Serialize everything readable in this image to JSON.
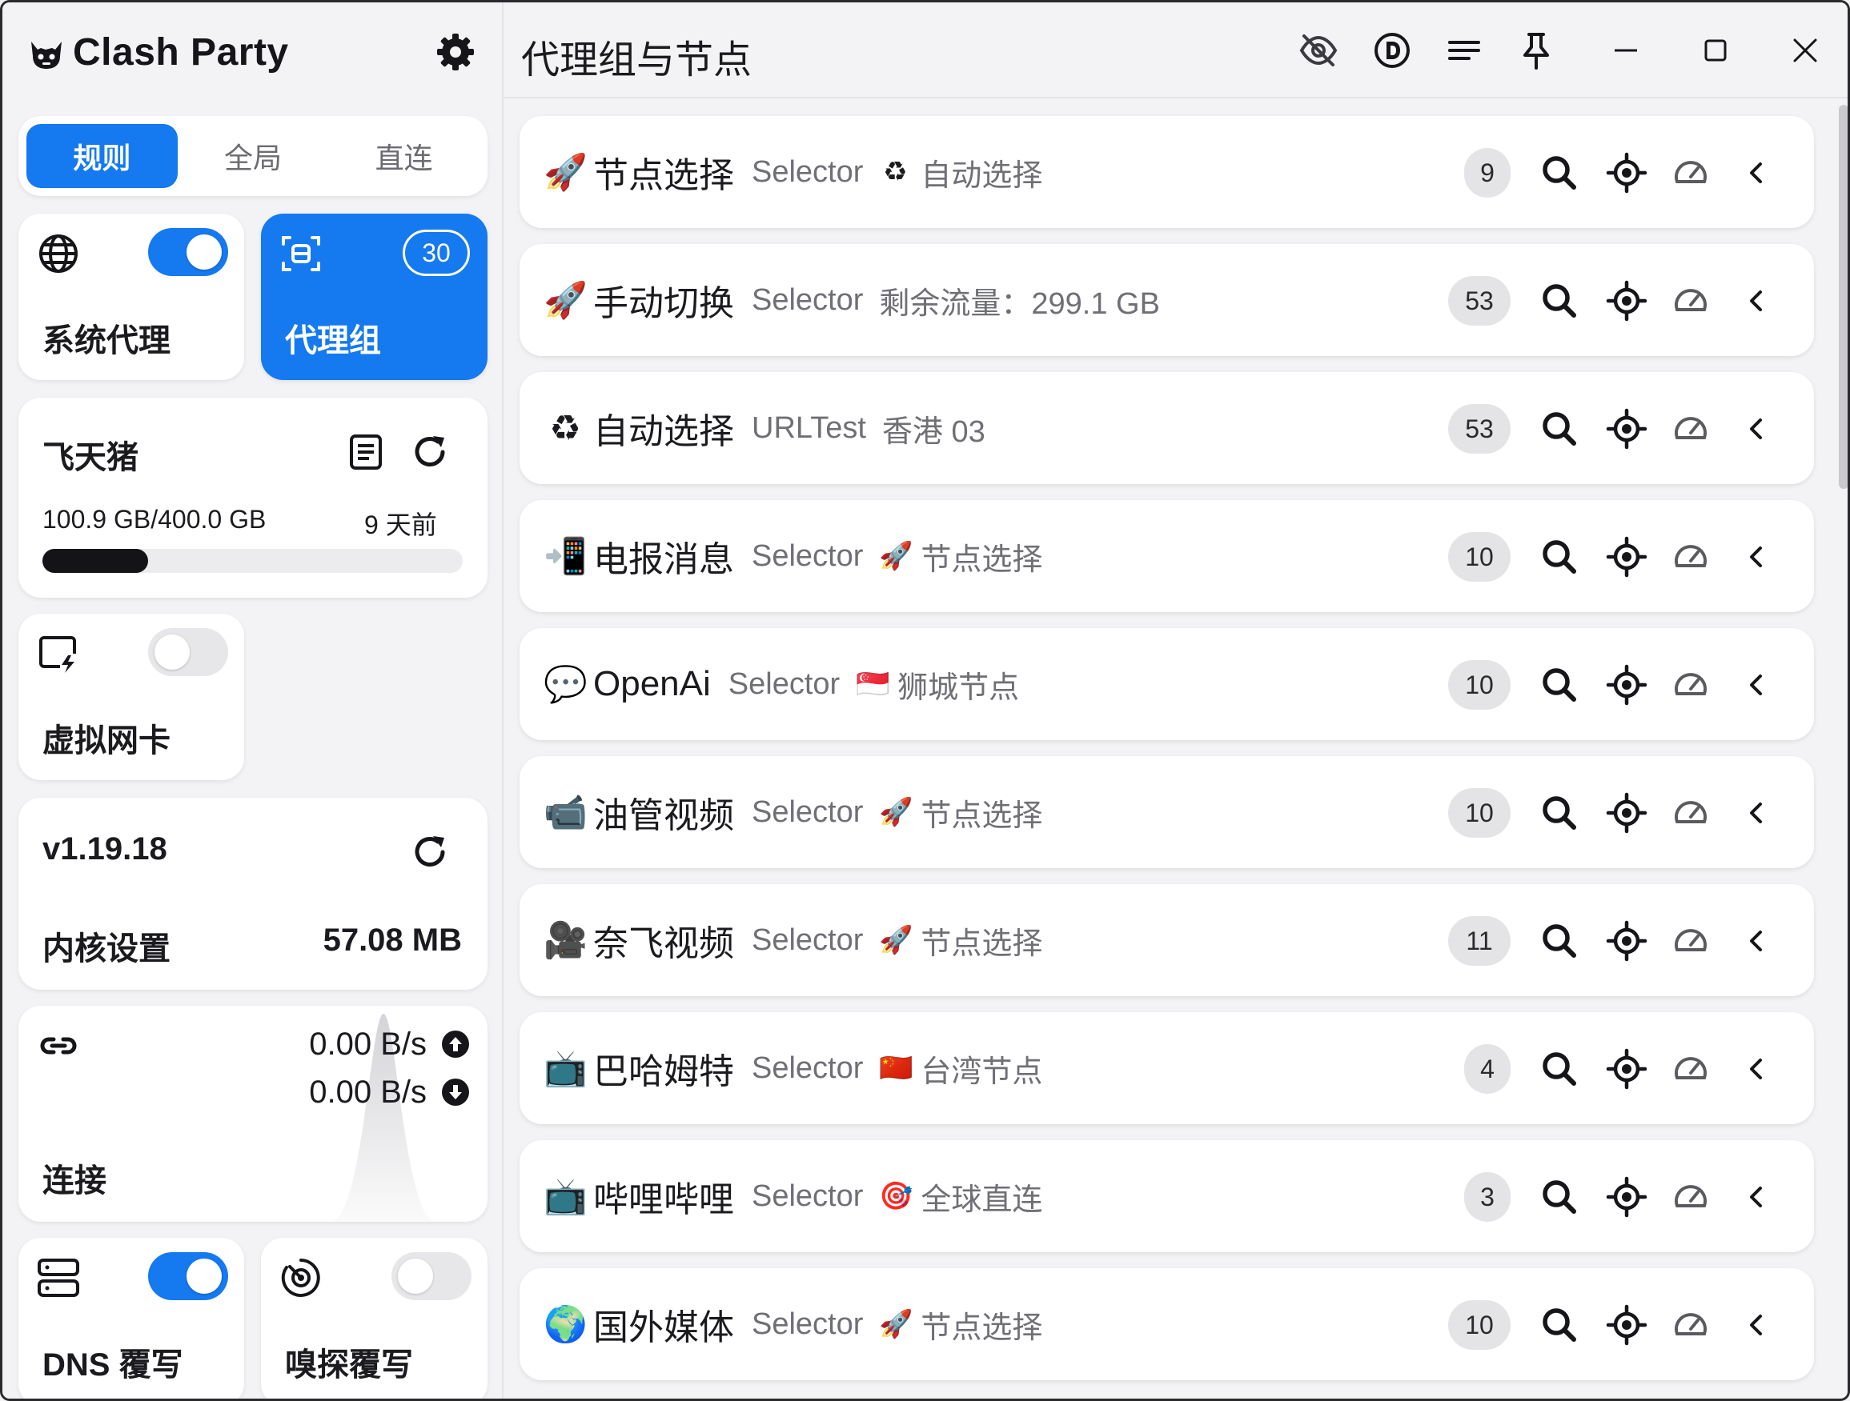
{
  "app": {
    "name": "Clash Party"
  },
  "modes": [
    {
      "label": "规则",
      "active": true
    },
    {
      "label": "全局",
      "active": false
    },
    {
      "label": "直连",
      "active": false
    }
  ],
  "system_proxy": {
    "label": "系统代理",
    "enabled": true
  },
  "proxy_groups_card": {
    "label": "代理组",
    "count": "30"
  },
  "subscription": {
    "name": "飞天猪",
    "usage": "100.9 GB/400.0 GB",
    "updated": "9 天前",
    "used_fraction": 0.2523
  },
  "tun": {
    "label": "虚拟网卡",
    "enabled": false
  },
  "core": {
    "version": "v1.19.18",
    "label": "内核设置",
    "memory": "57.08 MB"
  },
  "connections": {
    "label": "连接",
    "upload": "0.00 B/s",
    "download": "0.00 B/s"
  },
  "dns": {
    "label": "DNS 覆写",
    "enabled": true
  },
  "sniff": {
    "label": "嗅探覆写",
    "enabled": false
  },
  "page": {
    "title": "代理组与节点"
  },
  "groups": [
    {
      "emoji": "🚀",
      "name": "节点选择",
      "type": "Selector",
      "now_emoji": "♻",
      "now": "自动选择",
      "count": "9"
    },
    {
      "emoji": "🚀",
      "name": "手动切换",
      "type": "Selector",
      "now_emoji": "",
      "now": "剩余流量：299.1 GB",
      "count": "53"
    },
    {
      "emoji": "♻",
      "name": "自动选择",
      "type": "URLTest",
      "now_emoji": "",
      "now": "香港 03",
      "count": "53"
    },
    {
      "emoji": "📲",
      "name": "电报消息",
      "type": "Selector",
      "now_emoji": "🚀",
      "now": "节点选择",
      "count": "10"
    },
    {
      "emoji": "💬",
      "name": "OpenAi",
      "type": "Selector",
      "now_emoji": "🇸🇬",
      "now": "狮城节点",
      "count": "10"
    },
    {
      "emoji": "📹",
      "name": "油管视频",
      "type": "Selector",
      "now_emoji": "🚀",
      "now": "节点选择",
      "count": "10"
    },
    {
      "emoji": "🎥",
      "name": "奈飞视频",
      "type": "Selector",
      "now_emoji": "🚀",
      "now": "节点选择",
      "count": "11"
    },
    {
      "emoji": "📺",
      "name": "巴哈姆特",
      "type": "Selector",
      "now_emoji": "🇨🇳",
      "now": "台湾节点",
      "count": "4"
    },
    {
      "emoji": "📺",
      "name": "哔哩哔哩",
      "type": "Selector",
      "now_emoji": "🎯",
      "now": "全球直连",
      "count": "3"
    },
    {
      "emoji": "🌍",
      "name": "国外媒体",
      "type": "Selector",
      "now_emoji": "🚀",
      "now": "节点选择",
      "count": "10"
    }
  ],
  "colors": {
    "accent": "#1579f0",
    "card": "#ffffff",
    "background": "#f3f3f5",
    "muted_text": "#6f6f76"
  }
}
